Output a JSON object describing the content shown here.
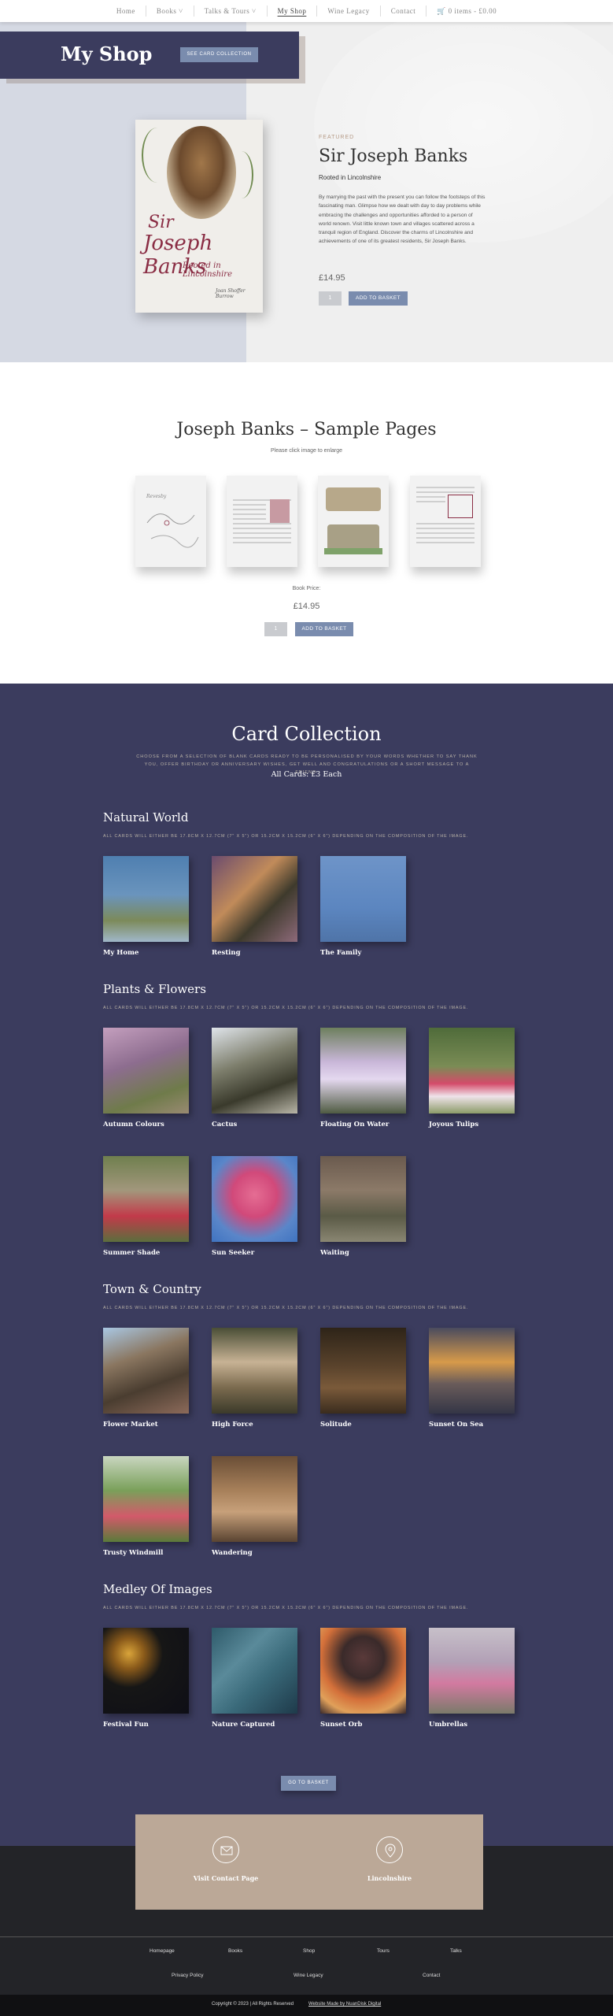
{
  "nav": {
    "items": [
      "Home",
      "Books ˅",
      "Talks & Tours ˅",
      "My Shop",
      "Wine Legacy",
      "Contact"
    ],
    "cart": "🛒 0 items - £0.00"
  },
  "hero": {
    "title": "My Shop",
    "see_cards": "SEE CARD COLLECTION",
    "featured_label": "FEATURED",
    "book_title": "Sir Joseph Banks",
    "book_subtitle": "Rooted in Lincolnshire",
    "description": "By marrying the past with the present you can follow the footsteps of this fascinating man. Glimpse how we dealt with day to day problems while embracing the challenges and opportunities afforded to a person of world renown. Visit little known town and villages scattered across a tranquil region of England. Discover the charms of Lincolnshire and achievements of one of its greatest residents, Sir Joseph Banks.",
    "price": "£14.95",
    "qty": "1",
    "add_to_basket": "ADD TO BASKET",
    "cover": {
      "line1": "Sir",
      "line2": "Joseph Banks",
      "subtitle": "Rooted in Lincolnshire",
      "author": "Joan Shoffer Burrow"
    }
  },
  "samples": {
    "title": "Joseph Banks – Sample Pages",
    "subtitle": "Please click image to enlarge",
    "price_label": "Book Price:",
    "price": "£14.95",
    "qty": "1",
    "add_to_basket": "ADD TO BASKET"
  },
  "cards": {
    "title": "Card Collection",
    "description": "CHOOSE FROM A SELECTION OF BLANK CARDS READY TO BE PERSONALISED BY YOUR WORDS WHETHER TO SAY THANK YOU, OFFER BIRTHDAY OR ANNIVERSARY WISHES, GET WELL AND CONGRATULATIONS OR A SHORT MESSAGE TO A FRIEND.",
    "price_line": "All Cards: £3 Each",
    "size_note": "ALL CARDS WILL EITHER BE 17.8CM X 12.7CM (7\" X 5\") OR 15.2CM X 15.2CM (6\" X 6\") DEPENDING ON THE COMPOSITION OF THE IMAGE.",
    "categories": [
      {
        "title": "Natural World",
        "items": [
          "My Home",
          "Resting",
          "The Family"
        ]
      },
      {
        "title": "Plants & Flowers",
        "items": [
          "Autumn Colours",
          "Cactus",
          "Floating On Water",
          "Joyous Tulips",
          "Summer Shade",
          "Sun Seeker",
          "Waiting"
        ]
      },
      {
        "title": "Town & Country",
        "items": [
          "Flower Market",
          "High Force",
          "Solitude",
          "Sunset On Sea",
          "Trusty Windmill",
          "Wandering"
        ]
      },
      {
        "title": "Medley Of Images",
        "items": [
          "Festival Fun",
          "Nature Captured",
          "Sunset Orb",
          "Umbrellas"
        ]
      }
    ],
    "go_basket": "GO TO BASKET"
  },
  "contact": {
    "visit": "Visit Contact Page",
    "location": "Lincolnshire"
  },
  "footer": {
    "links_row1": [
      "Homepage",
      "Books",
      "Shop",
      "Tours",
      "Talks"
    ],
    "links_row2": [
      "Privacy Policy",
      "Wine Legacy",
      "Contact"
    ],
    "copyright": "Copyright © 2023 | All Rights Reserved",
    "made_by": "Website Made by NuanDisk Digital"
  },
  "colors": {
    "navy": "#3b3c5e",
    "accent": "#7a8cae",
    "tan": "#bba897",
    "book_red": "#8a2d44"
  }
}
